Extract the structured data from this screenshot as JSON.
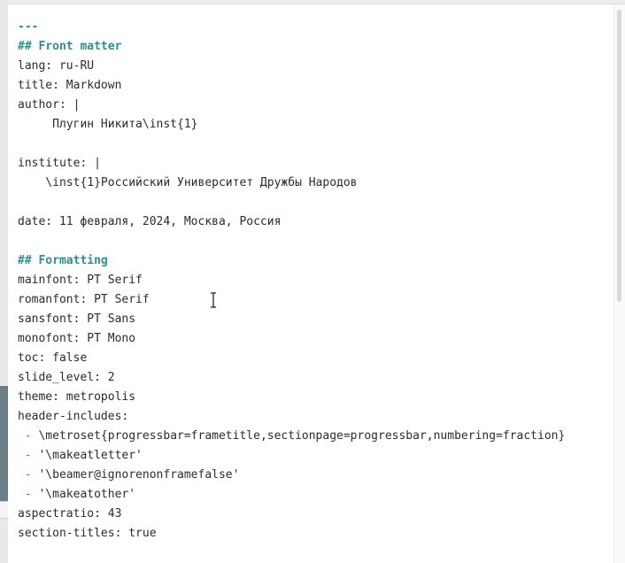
{
  "editor": {
    "separator": "---",
    "front_matter_heading": "## Front matter",
    "lang": "lang: ru-RU",
    "title": "title: Markdown",
    "author_key": "author: |",
    "author_value": "     Плугин Никита\\inst{1}",
    "institute_key": "institute: |",
    "institute_value": "    \\inst{1}Российский Университет Дружбы Народов",
    "date": "date: 11 февраля, 2024, Москва, Россия",
    "formatting_heading": "## Formatting",
    "mainfont": "mainfont: PT Serif",
    "romanfont": "romanfont: PT Serif",
    "sansfont": "sansfont: PT Sans",
    "monofont": "monofont: PT Mono",
    "toc": "toc: false",
    "slide_level": "slide_level: 2",
    "theme": "theme: metropolis",
    "header_includes": "header-includes:",
    "list_marker": " - ",
    "includes": [
      "\\metroset{progressbar=frametitle,sectionpage=progressbar,numbering=fraction}",
      "'\\makeatletter'",
      "'\\beamer@ignorenonframefalse'",
      "'\\makeatother'"
    ],
    "aspectratio": "aspectratio: 43",
    "section_titles": "section-titles: true"
  }
}
